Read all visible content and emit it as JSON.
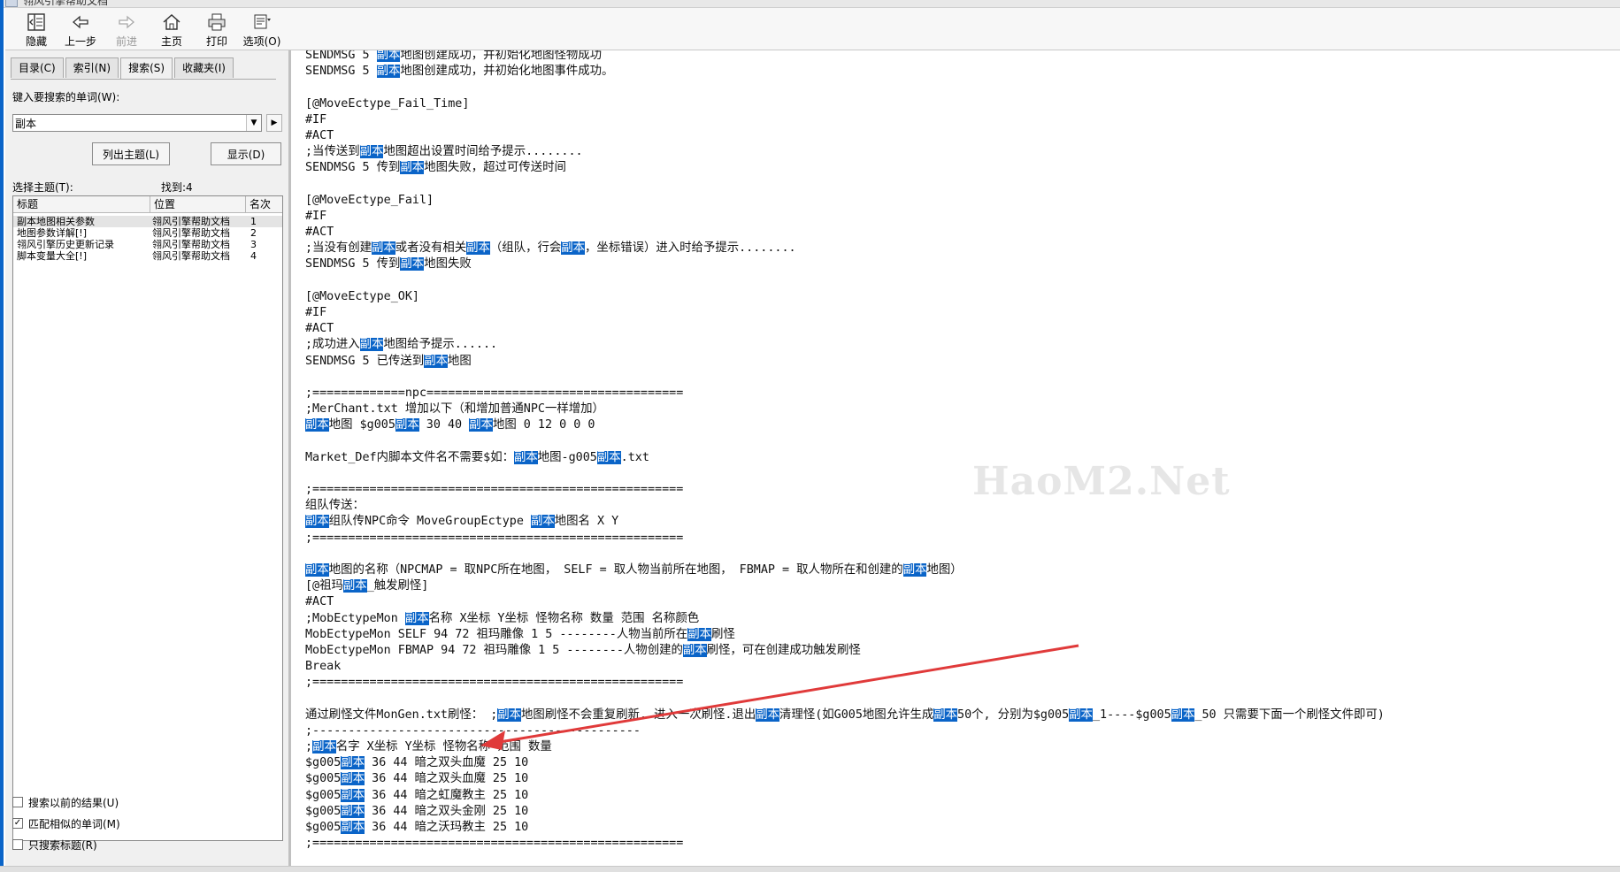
{
  "window": {
    "title": "翎风引擎帮助文档"
  },
  "toolbar": {
    "buttons": [
      {
        "id": "hide",
        "label": "隐藏",
        "icon": "hide-pane-icon",
        "enabled": true
      },
      {
        "id": "back",
        "label": "上一步",
        "icon": "back-arrow-icon",
        "enabled": true
      },
      {
        "id": "forward",
        "label": "前进",
        "icon": "forward-arrow-icon",
        "enabled": false
      },
      {
        "id": "home",
        "label": "主页",
        "icon": "home-icon",
        "enabled": true
      },
      {
        "id": "print",
        "label": "打印",
        "icon": "printer-icon",
        "enabled": true
      },
      {
        "id": "options",
        "label": "选项(O)",
        "icon": "options-icon",
        "enabled": true
      }
    ]
  },
  "left_pane": {
    "tabs": [
      {
        "label": "目录(C)",
        "active": false
      },
      {
        "label": "索引(N)",
        "active": false
      },
      {
        "label": "搜索(S)",
        "active": true
      },
      {
        "label": "收藏夹(I)",
        "active": false
      }
    ],
    "search_label": "键入要搜索的单词(W):",
    "search_value": "副本",
    "list_topics_button": "列出主题(L)",
    "display_button": "显示(D)",
    "select_topic_label": "选择主题(T):",
    "found_label": "找到:4",
    "columns": [
      "标题",
      "位置",
      "名次"
    ],
    "results": [
      {
        "title": "副本地图相关参数",
        "location": "翎风引擎帮助文档",
        "rank": "1"
      },
      {
        "title": "地图参数详解[!]",
        "location": "翎风引擎帮助文档",
        "rank": "2"
      },
      {
        "title": "翎风引擎历史更新记录",
        "location": "翎风引擎帮助文档",
        "rank": "3"
      },
      {
        "title": "脚本变量大全[!]",
        "location": "翎风引擎帮助文档",
        "rank": "4"
      }
    ],
    "options": [
      {
        "label": "搜索以前的结果(U)",
        "checked": false
      },
      {
        "label": "匹配相似的单词(M)",
        "checked": true
      },
      {
        "label": "只搜索标题(R)",
        "checked": false
      }
    ]
  },
  "content": {
    "highlight_term": "副本",
    "highlight_color": "#0a64c8",
    "watermark": "HaoM2.Net",
    "lines": [
      "SENDMSG 5 副本地图创建成功，并初始化地图怪物成功",
      "SENDMSG 5 副本地图创建成功，并初始化地图事件成功。",
      "",
      "[@MoveEctype_Fail_Time]",
      "#IF",
      "#ACT",
      ";当传送到副本地图超出设置时间给予提示........",
      "SENDMSG 5 传到副本地图失败，超过可传送时间",
      "",
      "[@MoveEctype_Fail]",
      "#IF",
      "#ACT",
      ";当没有创建副本或者没有相关副本（组队，行会副本，坐标错误）进入时给予提示........",
      "SENDMSG 5 传到副本地图失败",
      "",
      "[@MoveEctype_OK]",
      "#IF",
      "#ACT",
      ";成功进入副本地图给予提示......",
      "SENDMSG 5 已传送到副本地图",
      "",
      ";=============npc====================================",
      ";MerChant.txt 增加以下（和增加普通NPC一样增加）",
      "副本地图 $g005副本 30 40 副本地图 0 12 0 0 0",
      "",
      "Market_Def内脚本文件名不需要$如：副本地图-g005副本.txt",
      "",
      ";====================================================",
      "组队传送：",
      "副本组队传NPC命令 MoveGroupEctype 副本地图名 X Y",
      ";====================================================",
      "",
      "副本地图的名称（NPCMAP = 取NPC所在地图， SELF = 取人物当前所在地图， FBMAP = 取人物所在和创建的副本地图）",
      "[@祖玛副本_触发刷怪]",
      "#ACT",
      ";MobEctypeMon 副本名称 X坐标 Y坐标 怪物名称 数量 范围 名称颜色",
      "MobEctypeMon SELF 94 72 祖玛雕像 1 5 --------人物当前所在副本刷怪",
      "MobEctypeMon FBMAP 94 72 祖玛雕像 1 5 --------人物创建的副本刷怪，可在创建成功触发刷怪",
      "Break",
      ";====================================================",
      "",
      "通过刷怪文件MonGen.txt刷怪： ;副本地图刷怪不会重复刷新..进入一次刷怪.退出副本清理怪(如G005地图允许生成副本50个, 分别为$g005副本_1----$g005副本_50 只需要下面一个刷怪文件即可)",
      ";----------------------------------------------",
      ";副本名字 X坐标 Y坐标 怪物名称 范围 数量",
      "$g005副本 36 44 暗之双头血魔 25 10",
      "$g005副本 36 44 暗之双头血魔 25 10",
      "$g005副本 36 44 暗之虹魔教主 25 10",
      "$g005副本 36 44 暗之双头金刚 25 10",
      "$g005副本 36 44 暗之沃玛教主 25 10",
      ";===================================================="
    ]
  }
}
